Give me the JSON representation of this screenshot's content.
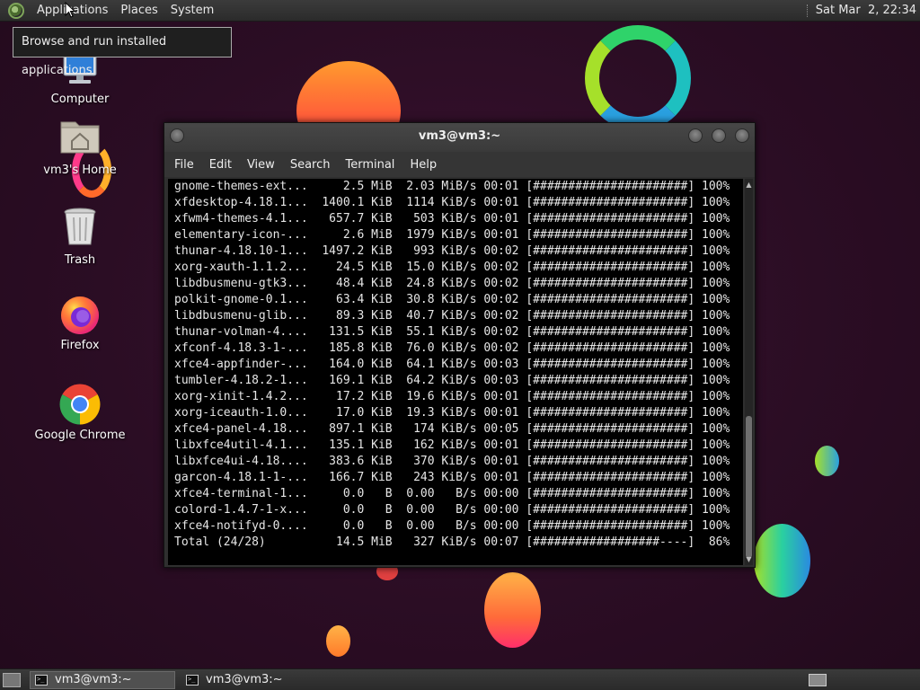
{
  "top_panel": {
    "menus": [
      "Applications",
      "Places",
      "System"
    ],
    "clock": "Sat Mar  2, 22:34"
  },
  "tooltip": "Browse and run installed applications",
  "desktop_icons": [
    {
      "label": "Computer",
      "icon": "computer-icon"
    },
    {
      "label": "vm3's Home",
      "icon": "home-folder-icon"
    },
    {
      "label": "Trash",
      "icon": "trash-icon"
    },
    {
      "label": "Firefox",
      "icon": "firefox-icon"
    },
    {
      "label": "Google Chrome",
      "icon": "chrome-icon"
    }
  ],
  "terminal": {
    "title": "vm3@vm3:~",
    "menus": [
      "File",
      "Edit",
      "View",
      "Search",
      "Terminal",
      "Help"
    ],
    "lines": [
      "gnome-themes-ext...     2.5 MiB  2.03 MiB/s 00:01 [######################] 100%",
      "xfdesktop-4.18.1...  1400.1 KiB  1114 KiB/s 00:01 [######################] 100%",
      "xfwm4-themes-4.1...   657.7 KiB   503 KiB/s 00:01 [######################] 100%",
      "elementary-icon-...     2.6 MiB  1979 KiB/s 00:01 [######################] 100%",
      "thunar-4.18.10-1...  1497.2 KiB   993 KiB/s 00:02 [######################] 100%",
      "xorg-xauth-1.1.2...    24.5 KiB  15.0 KiB/s 00:02 [######################] 100%",
      "libdbusmenu-gtk3...    48.4 KiB  24.8 KiB/s 00:02 [######################] 100%",
      "polkit-gnome-0.1...    63.4 KiB  30.8 KiB/s 00:02 [######################] 100%",
      "libdbusmenu-glib...    89.3 KiB  40.7 KiB/s 00:02 [######################] 100%",
      "thunar-volman-4....   131.5 KiB  55.1 KiB/s 00:02 [######################] 100%",
      "xfconf-4.18.3-1-...   185.8 KiB  76.0 KiB/s 00:02 [######################] 100%",
      "xfce4-appfinder-...   164.0 KiB  64.1 KiB/s 00:03 [######################] 100%",
      "tumbler-4.18.2-1...   169.1 KiB  64.2 KiB/s 00:03 [######################] 100%",
      "xorg-xinit-1.4.2...    17.2 KiB  19.6 KiB/s 00:01 [######################] 100%",
      "xorg-iceauth-1.0...    17.0 KiB  19.3 KiB/s 00:01 [######################] 100%",
      "xfce4-panel-4.18...   897.1 KiB   174 KiB/s 00:05 [######################] 100%",
      "libxfce4util-4.1...   135.1 KiB   162 KiB/s 00:01 [######################] 100%",
      "libxfce4ui-4.18....   383.6 KiB   370 KiB/s 00:01 [######################] 100%",
      "garcon-4.18.1-1-...   166.7 KiB   243 KiB/s 00:01 [######################] 100%",
      "xfce4-terminal-1...     0.0   B  0.00   B/s 00:00 [######################] 100%",
      "colord-1.4.7-1-x...     0.0   B  0.00   B/s 00:00 [######################] 100%",
      "xfce4-notifyd-0....     0.0   B  0.00   B/s 00:00 [######################] 100%",
      "Total (24/28)          14.5 MiB   327 KiB/s 00:07 [##################----]  86%"
    ]
  },
  "taskbar": {
    "tasks": [
      "vm3@vm3:~",
      "vm3@vm3:~"
    ]
  },
  "colors": {
    "terminal_bg": "#000000",
    "panel_bg": "#2b2b2b",
    "desktop_bg": "#2a0f22"
  }
}
